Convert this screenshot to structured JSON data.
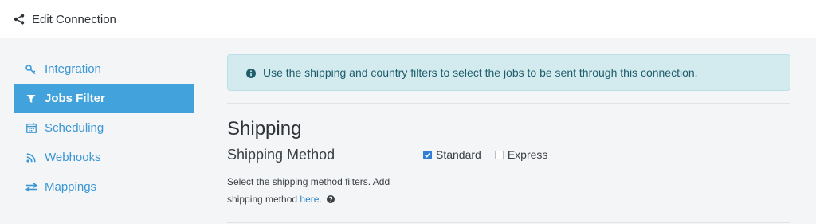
{
  "header": {
    "title": "Edit Connection",
    "icon": "share-icon"
  },
  "sidebar": {
    "items": [
      {
        "label": "Integration",
        "icon": "key-icon",
        "active": false
      },
      {
        "label": "Jobs Filter",
        "icon": "filter-icon",
        "active": true
      },
      {
        "label": "Scheduling",
        "icon": "calendar-icon",
        "active": false
      },
      {
        "label": "Webhooks",
        "icon": "rss-icon",
        "active": false
      },
      {
        "label": "Mappings",
        "icon": "exchange-icon",
        "active": false
      }
    ]
  },
  "alert": {
    "text": "Use the shipping and country filters to select the jobs to be sent through this connection.",
    "icon": "info-icon"
  },
  "shipping": {
    "section_title": "Shipping",
    "method_label": "Shipping Method",
    "help_text": "Select the shipping method filters. Add shipping method",
    "help_link": "here",
    "help_suffix": ".",
    "options": [
      {
        "label": "Standard",
        "checked": true
      },
      {
        "label": "Express",
        "checked": false
      }
    ]
  },
  "colors": {
    "accent": "#42a3dc",
    "link": "#3a97d4",
    "alert_bg": "#d3eaef",
    "checkbox": "#2f7fd6"
  }
}
